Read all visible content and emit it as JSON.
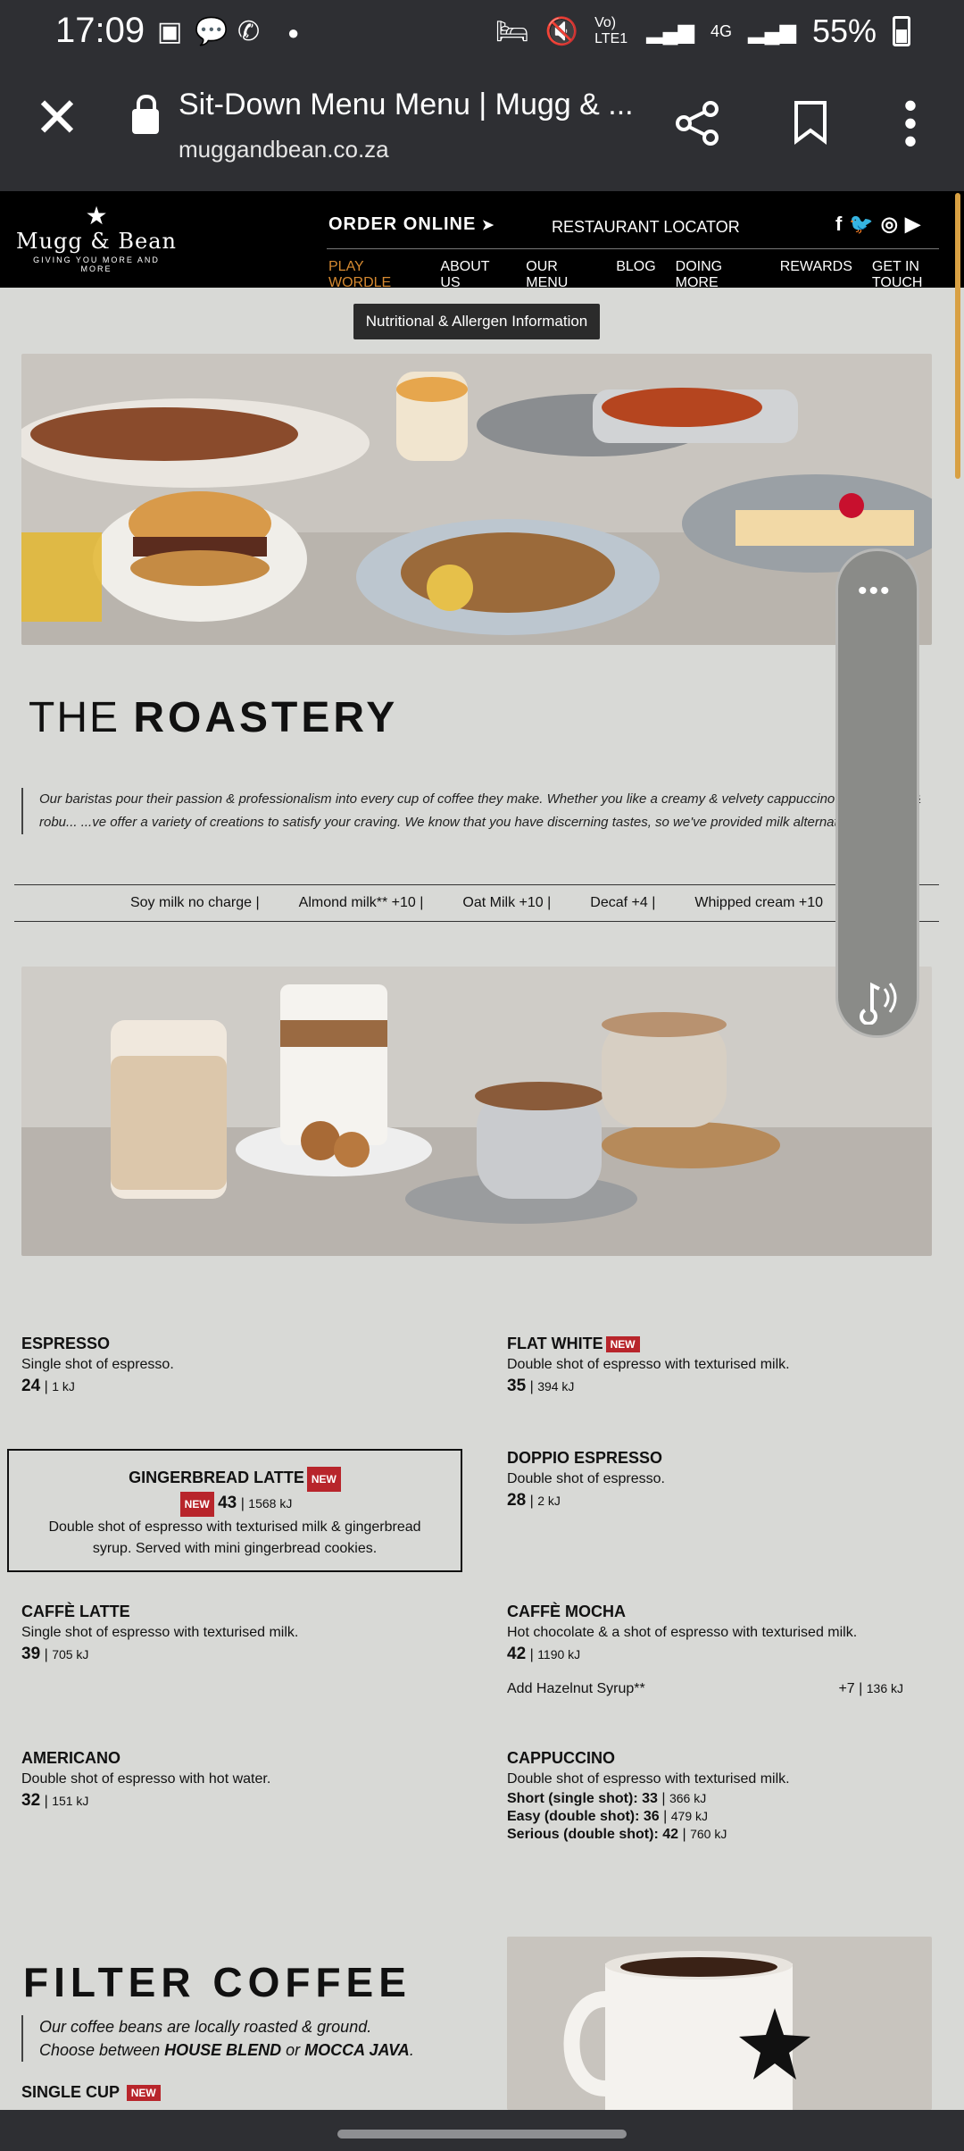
{
  "status": {
    "time": "17:09",
    "network": "Vo) LTE1",
    "net4g": "4G",
    "battery": "55%"
  },
  "browser": {
    "title": "Sit-Down Menu Menu | Mugg & ...",
    "url": "muggandbean.co.za"
  },
  "site": {
    "logo_name": "Mugg & Bean",
    "logo_tag": "GIVING YOU MORE AND MORE",
    "order_online": "ORDER ONLINE",
    "restaurant_locator": "RESTAURANT LOCATOR",
    "nav": [
      "PLAY WORDLE",
      "ABOUT US",
      "OUR MENU",
      "BLOG",
      "DOING MORE",
      "REWARDS",
      "GET IN TOUCH"
    ]
  },
  "allergen_button": "Nutritional & Allergen Information",
  "roastery": {
    "title_thin": "THE",
    "title_bold": "ROASTERY",
    "quote": "Our baristas pour their passion & professionalism into every cup of coffee they make. Whether you like a creamy & velvety cappuccino or a reliable & robu... ...ve offer a variety of creations to satisfy your craving. We know that you have discerning tastes, so we've provided milk alternatives too.",
    "milk_options": [
      "Soy milk no charge |",
      "Almond milk** +10 |",
      "Oat Milk +10 |",
      "Decaf +4 |",
      "Whipped cream +10"
    ]
  },
  "menu": {
    "new_label": "NEW",
    "espresso": {
      "name": "ESPRESSO",
      "desc": "Single shot of espresso.",
      "price": "24",
      "kj": "1 kJ"
    },
    "flat_white": {
      "name": "FLAT WHITE",
      "desc": "Double shot of espresso with texturised milk.",
      "price": "35",
      "kj": "394 kJ"
    },
    "gingerbread": {
      "name": "GINGERBREAD LATTE",
      "price": "43",
      "kj": "1568 kJ",
      "desc1": "Double shot of espresso with texturised milk & gingerbread",
      "desc2": "syrup. Served with mini gingerbread cookies."
    },
    "doppio": {
      "name": "DOPPIO ESPRESSO",
      "desc": "Double shot of espresso.",
      "price": "28",
      "kj": "2 kJ"
    },
    "caffe_latte": {
      "name": "CAFFÈ LATTE",
      "desc": "Single shot of espresso with texturised milk.",
      "price": "39",
      "kj": "705 kJ"
    },
    "caffe_mocha": {
      "name": "CAFFÈ MOCHA",
      "desc": "Hot chocolate & a shot of espresso with texturised milk.",
      "price": "42",
      "kj": "1190 kJ"
    },
    "hazelnut": {
      "label": "Add Hazelnut Syrup**",
      "price": "+7",
      "kj": "136 kJ"
    },
    "americano": {
      "name": "AMERICANO",
      "desc": "Double shot of espresso with hot water.",
      "price": "32",
      "kj": "151 kJ"
    },
    "cappuccino": {
      "name": "CAPPUCCINO",
      "desc": "Double shot of espresso with texturised milk.",
      "sizes": [
        {
          "label": "Short (single shot):",
          "price": "33",
          "kj": "366 kJ"
        },
        {
          "label": "Easy (double shot):",
          "price": "36",
          "kj": "479 kJ"
        },
        {
          "label": "Serious (double shot):",
          "price": "42",
          "kj": "760 kJ"
        }
      ]
    }
  },
  "filter": {
    "title": "FILTER COFFEE",
    "line1": "Our coffee beans are locally roasted & ground.",
    "line2_pre": "Choose between ",
    "blend1": "HOUSE BLEND",
    "line2_mid": " or ",
    "blend2": "MOCCA JAVA",
    "line2_end": ".",
    "single_cup": "SINGLE CUP"
  }
}
